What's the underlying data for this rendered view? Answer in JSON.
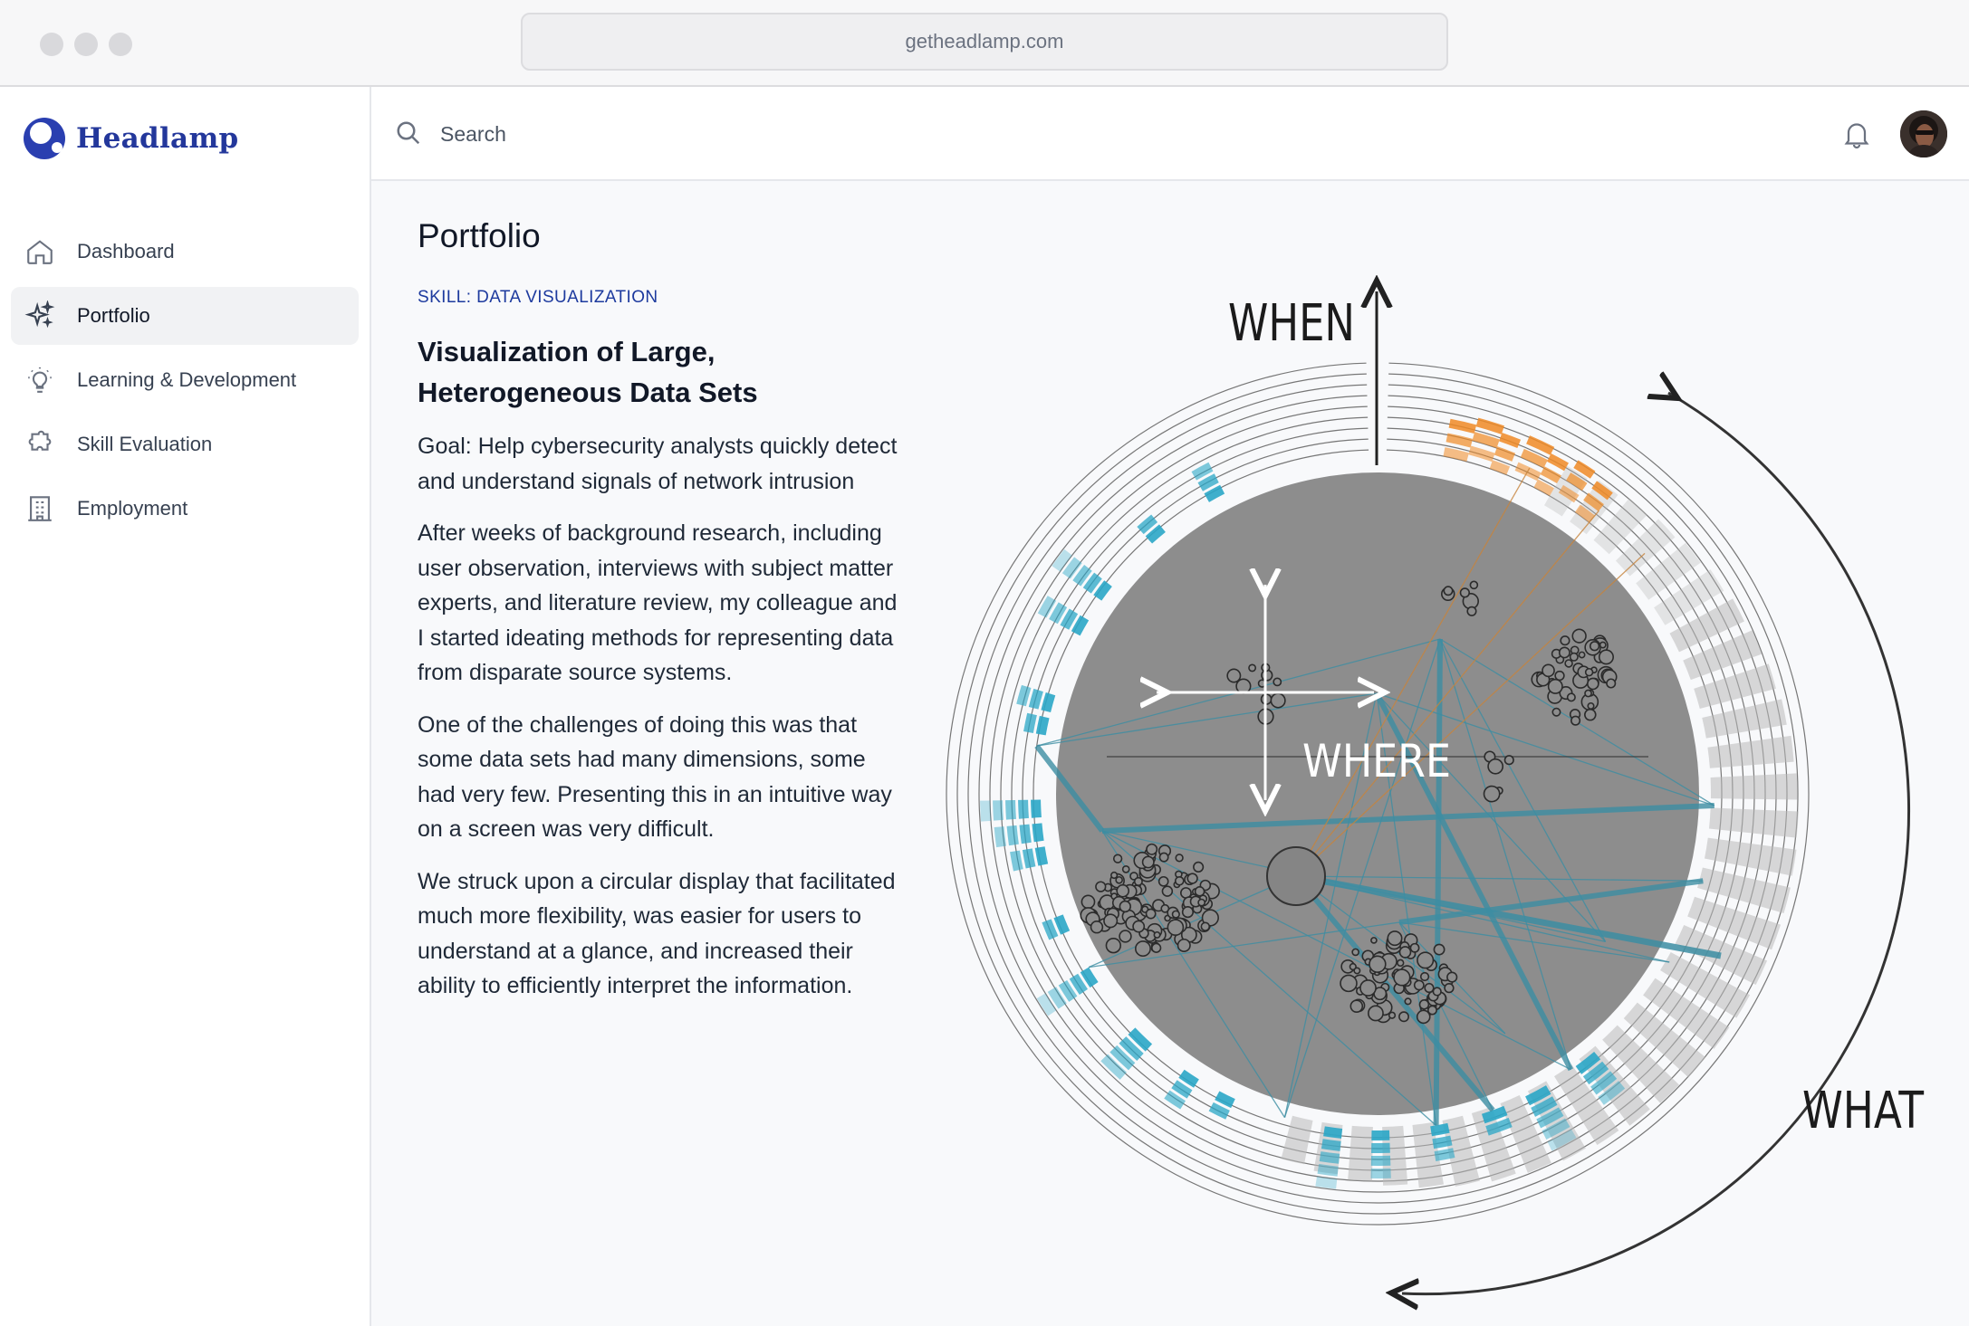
{
  "browser": {
    "url": "getheadlamp.com"
  },
  "brand": {
    "name": "Headlamp",
    "color": "#23379b"
  },
  "sidebar": {
    "items": [
      {
        "label": "Dashboard",
        "icon": "home-icon",
        "active": false
      },
      {
        "label": "Portfolio",
        "icon": "sparkle-icon",
        "active": true
      },
      {
        "label": "Learning & Development",
        "icon": "lightbulb-icon",
        "active": false
      },
      {
        "label": "Skill Evaluation",
        "icon": "puzzle-icon",
        "active": false
      },
      {
        "label": "Employment",
        "icon": "building-icon",
        "active": false
      }
    ]
  },
  "topbar": {
    "search_placeholder": "Search",
    "bell_icon": "bell-icon",
    "avatar": "user-avatar"
  },
  "main": {
    "title": "Portfolio",
    "skill_tag": "SKILL: DATA VISUALIZATION",
    "project_title_line1": "Visualization of Large,",
    "project_title_line2": "Heterogeneous Data Sets",
    "paragraphs": [
      "Goal: Help cybersecurity analysts quickly detect and understand signals of network intrusion",
      "After weeks of background research, including user observation, interviews with subject matter experts, and literature review, my colleague and I started ideating methods for representing data from disparate source systems.",
      "One of the challenges of doing this was that some data sets had many dimensions, some had very few. Presenting this in an intuitive way on a screen was very difficult.",
      "We struck upon a circular display that facilitated much more flexibility, was easier for users to understand at a glance, and increased their ability to efficiently interpret the information."
    ]
  },
  "visualization": {
    "labels": {
      "when": "WHEN",
      "where": "WHERE",
      "what": "WHAT"
    },
    "colors": {
      "blue": "#2aa6c6",
      "orange": "#f08a24",
      "gray": "#8e8e8e"
    }
  }
}
